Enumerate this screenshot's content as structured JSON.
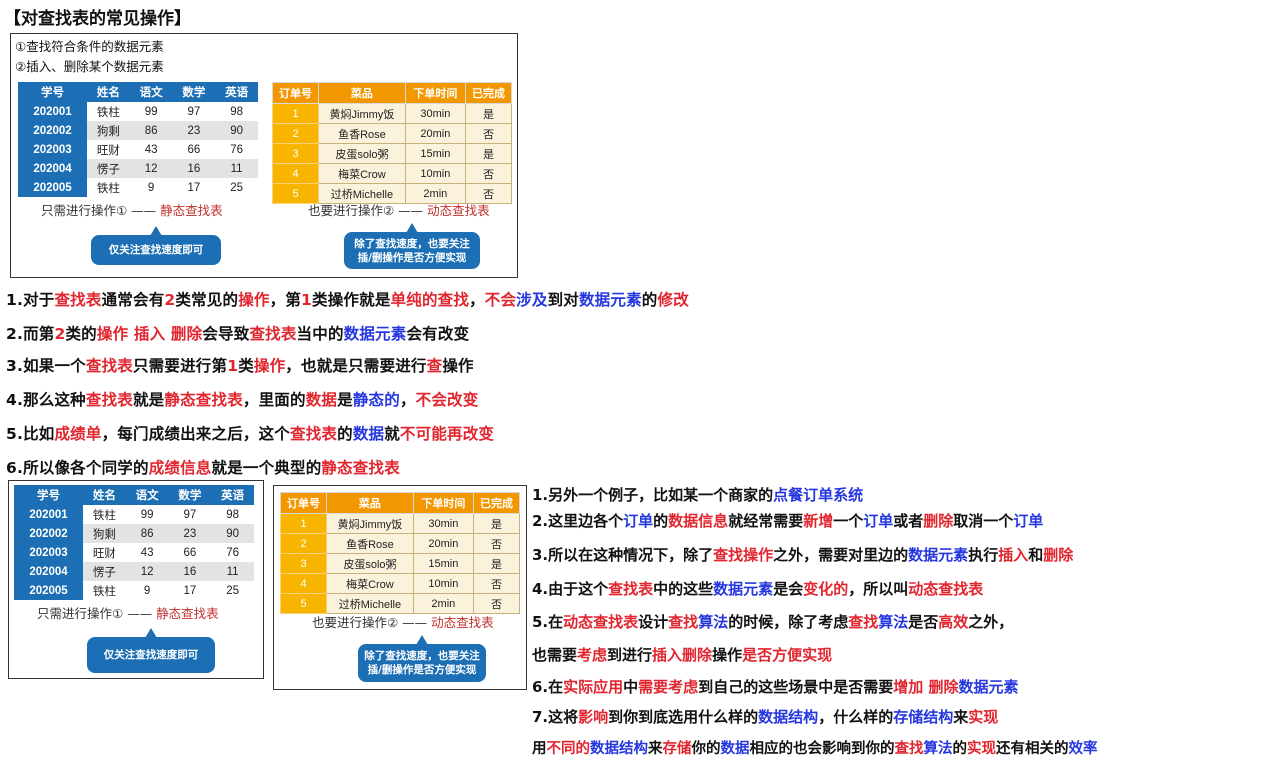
{
  "title": "【对查找表的常见操作】",
  "ops": [
    "①查找符合条件的数据元素",
    "②插入、删除某个数据元素"
  ],
  "student_table": {
    "headers": [
      "学号",
      "姓名",
      "语文",
      "数学",
      "英语"
    ],
    "rows": [
      [
        "202001",
        "铁柱",
        "99",
        "97",
        "98"
      ],
      [
        "202002",
        "狗剩",
        "86",
        "23",
        "90"
      ],
      [
        "202003",
        "旺财",
        "43",
        "66",
        "76"
      ],
      [
        "202004",
        "愣子",
        "12",
        "16",
        "11"
      ],
      [
        "202005",
        "铁柱",
        "9",
        "17",
        "25"
      ]
    ]
  },
  "order_table": {
    "headers": [
      "订单号",
      "菜品",
      "下单时间",
      "已完成"
    ],
    "rows": [
      [
        "1",
        "黄焖Jimmy饭",
        "30min",
        "是"
      ],
      [
        "2",
        "鱼香Rose",
        "20min",
        "否"
      ],
      [
        "3",
        "皮蛋solo粥",
        "15min",
        "是"
      ],
      [
        "4",
        "梅菜Crow",
        "10min",
        "否"
      ],
      [
        "5",
        "过桥Michelle",
        "2min",
        "否"
      ]
    ]
  },
  "caption_static": {
    "prefix": "只需进行操作① —— ",
    "highlight": "静态查找表"
  },
  "caption_dynamic": {
    "prefix": "也要进行操作② —— ",
    "highlight": "动态查找表"
  },
  "bubble_static": "仅关注查找速度即可",
  "bubble_dynamic_1": "除了查找速度，也要关注",
  "bubble_dynamic_2": "插/删操作是否方便实现",
  "notes_top": [
    [
      [
        "1.对于",
        ""
      ],
      [
        "查找表",
        "r"
      ],
      [
        "通常会有",
        ""
      ],
      [
        "2",
        "r"
      ],
      [
        "类常见的",
        ""
      ],
      [
        "操作",
        "r"
      ],
      [
        "，第",
        ""
      ],
      [
        "1",
        "r"
      ],
      [
        "类操作就是",
        ""
      ],
      [
        "单纯的查找",
        "r"
      ],
      [
        "，",
        ""
      ],
      [
        "不会",
        "r"
      ],
      [
        "涉及",
        "b"
      ],
      [
        "到对",
        ""
      ],
      [
        "数据元素",
        "b"
      ],
      [
        "的",
        ""
      ],
      [
        "修改",
        "r"
      ]
    ],
    [
      [
        "2.而第",
        ""
      ],
      [
        "2",
        "r"
      ],
      [
        "类的",
        ""
      ],
      [
        "操作",
        "r"
      ],
      [
        " ",
        ""
      ],
      [
        "插入",
        "r"
      ],
      [
        " ",
        ""
      ],
      [
        "删除",
        "r"
      ],
      [
        "会导致",
        ""
      ],
      [
        "查找表",
        "r"
      ],
      [
        "当中的",
        ""
      ],
      [
        "数据元素",
        "b"
      ],
      [
        "会有改变",
        ""
      ]
    ],
    [
      [
        "3.如果一个",
        ""
      ],
      [
        "查找表",
        "r"
      ],
      [
        "只需要进行第",
        ""
      ],
      [
        "1",
        "r"
      ],
      [
        "类",
        ""
      ],
      [
        "操作",
        "r"
      ],
      [
        "，也就是只需要进行",
        ""
      ],
      [
        "查",
        "r"
      ],
      [
        "操作",
        ""
      ]
    ],
    [
      [
        "4.那么这种",
        ""
      ],
      [
        "查找表",
        "r"
      ],
      [
        "就是",
        ""
      ],
      [
        "静态查找表",
        "r"
      ],
      [
        "，里面的",
        ""
      ],
      [
        "数据",
        "r"
      ],
      [
        "是",
        ""
      ],
      [
        "静态的",
        "b"
      ],
      [
        "，",
        ""
      ],
      [
        "不会改变",
        "r"
      ]
    ],
    [
      [
        "5.比如",
        ""
      ],
      [
        "成绩单",
        "r"
      ],
      [
        "，每门成绩出来之后，这个",
        ""
      ],
      [
        "查找表",
        "r"
      ],
      [
        "的",
        ""
      ],
      [
        "数据",
        "b"
      ],
      [
        "就",
        ""
      ],
      [
        "不可能再改变",
        "r"
      ]
    ],
    [
      [
        "6.所以像各个同学的",
        ""
      ],
      [
        "成绩信息",
        "r"
      ],
      [
        "就是一个典型的",
        ""
      ],
      [
        "静态查找表",
        "r"
      ]
    ]
  ],
  "notes_right": [
    [
      [
        "1.另外一个例子，比如某一个商家的",
        ""
      ],
      [
        "点餐订单系统",
        "b"
      ]
    ],
    [
      [
        "2.这里边各个",
        ""
      ],
      [
        "订单",
        "b"
      ],
      [
        "的",
        ""
      ],
      [
        "数据信息",
        "r"
      ],
      [
        "就经常需要",
        ""
      ],
      [
        "新增",
        "r"
      ],
      [
        "一个",
        ""
      ],
      [
        "订单",
        "b"
      ],
      [
        "或者",
        ""
      ],
      [
        "删除",
        "r"
      ],
      [
        "取消一个",
        ""
      ],
      [
        "订单",
        "b"
      ]
    ],
    [
      [
        "3.所以在这种情况下，除了",
        ""
      ],
      [
        "查找操作",
        "r"
      ],
      [
        "之外，需要对里边的",
        ""
      ],
      [
        "数据元素",
        "b"
      ],
      [
        "执行",
        ""
      ],
      [
        "插入",
        "r"
      ],
      [
        "和",
        ""
      ],
      [
        "删除",
        "r"
      ]
    ],
    [
      [
        "4.由于这个",
        ""
      ],
      [
        "查找表",
        "r"
      ],
      [
        "中的这些",
        ""
      ],
      [
        "数据元素",
        "b"
      ],
      [
        "是会",
        ""
      ],
      [
        "变化的",
        "r"
      ],
      [
        "，所以叫",
        ""
      ],
      [
        "动态查找表",
        "r"
      ]
    ],
    [
      [
        "5.在",
        ""
      ],
      [
        "动态查找表",
        "r"
      ],
      [
        "设计",
        ""
      ],
      [
        "查找",
        "r"
      ],
      [
        "算法",
        "b"
      ],
      [
        "的时候，除了考虑",
        ""
      ],
      [
        "查找",
        "r"
      ],
      [
        "算法",
        "b"
      ],
      [
        "是否",
        ""
      ],
      [
        "高效",
        "r"
      ],
      [
        "之外，",
        ""
      ]
    ],
    [
      [
        "  也需要",
        ""
      ],
      [
        "考虑",
        "r"
      ],
      [
        "到进行",
        ""
      ],
      [
        "插入删除",
        "r"
      ],
      [
        "操作",
        ""
      ],
      [
        "是否方便实现",
        "r"
      ]
    ],
    [
      [
        "6.在",
        ""
      ],
      [
        "实际应用",
        "r"
      ],
      [
        "中",
        ""
      ],
      [
        "需要考虑",
        "r"
      ],
      [
        "到自己的这些场景中是否需要",
        ""
      ],
      [
        "增加",
        "r"
      ],
      [
        " ",
        ""
      ],
      [
        "删除",
        "r"
      ],
      [
        "数据元素",
        "b"
      ]
    ],
    [
      [
        "7.这将",
        ""
      ],
      [
        "影响",
        "r"
      ],
      [
        "到你到底选用什么样的",
        ""
      ],
      [
        "数据结构",
        "b"
      ],
      [
        "，什么样的",
        ""
      ],
      [
        "存储结构",
        "b"
      ],
      [
        "来",
        ""
      ],
      [
        "实现",
        "r"
      ]
    ],
    [
      [
        "  用",
        ""
      ],
      [
        "不同的",
        "r"
      ],
      [
        "数据结构",
        "b"
      ],
      [
        "来",
        ""
      ],
      [
        "存储",
        "r"
      ],
      [
        "你的",
        ""
      ],
      [
        "数据",
        "b"
      ],
      [
        "相应的也会影响到你的",
        ""
      ],
      [
        "查找",
        "r"
      ],
      [
        "算法",
        "b"
      ],
      [
        "的",
        ""
      ],
      [
        "实现",
        "r"
      ],
      [
        "还有相关的",
        ""
      ],
      [
        "效率",
        "b"
      ]
    ]
  ]
}
